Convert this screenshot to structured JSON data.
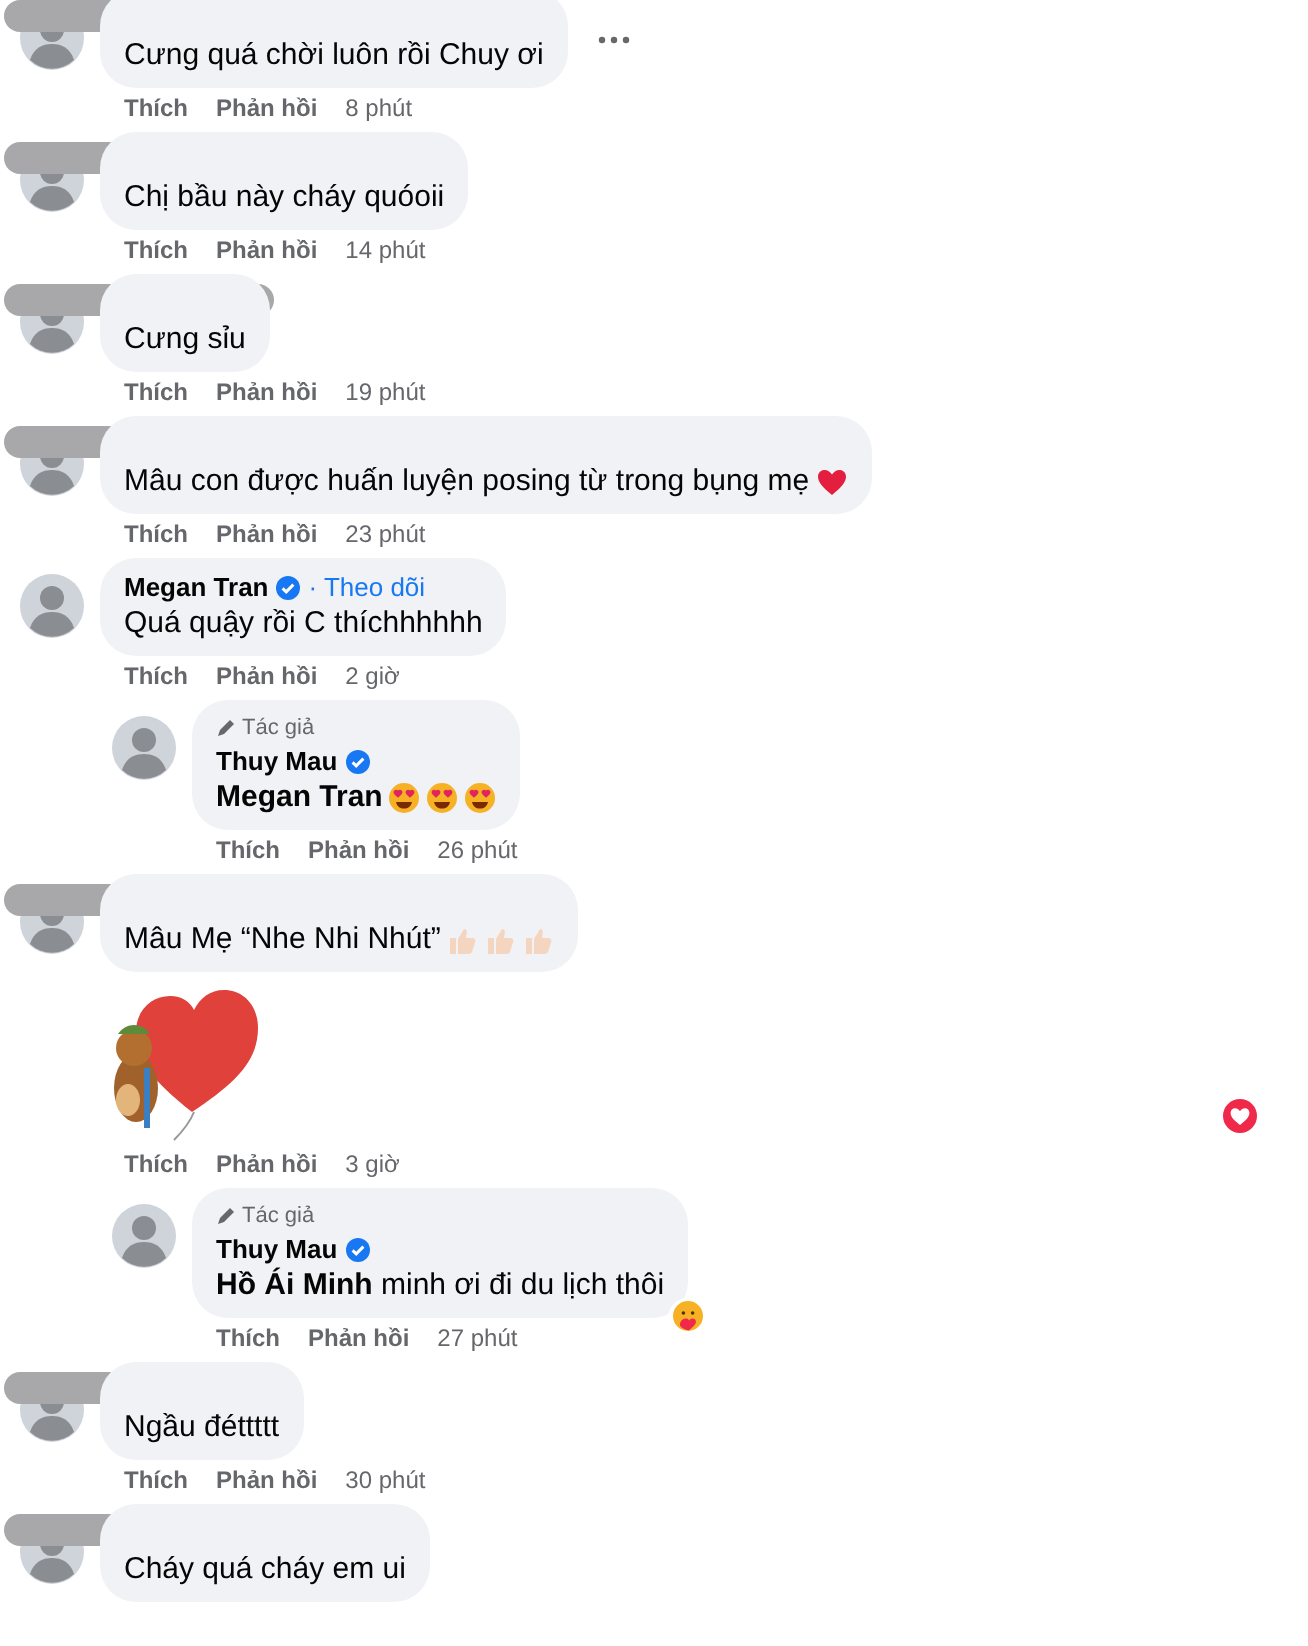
{
  "comments": [
    {
      "kind": "comment",
      "name_blurred": true,
      "text": "Cưng quá chời luôn rồi Chuy ơi",
      "more_menu": true,
      "actions": [
        "Thích",
        "Phản hồi"
      ],
      "time": "8 phút"
    },
    {
      "kind": "comment",
      "name_blurred": true,
      "text": "Chị bầu này cháy quóoii",
      "actions": [
        "Thích",
        "Phản hồi"
      ],
      "time": "14 phút"
    },
    {
      "kind": "comment",
      "name_blurred": true,
      "text": "Cưng sỉu",
      "actions": [
        "Thích",
        "Phản hồi"
      ],
      "time": "19 phút"
    },
    {
      "kind": "comment",
      "name_blurred": true,
      "text": "Mâu con được huấn luyện posing từ trong bụng mẹ",
      "trailing_icons": [
        {
          "kind": "heart"
        }
      ],
      "actions": [
        "Thích",
        "Phản hồi"
      ],
      "time": "23 phút"
    },
    {
      "kind": "comment",
      "name": "Megan Tran",
      "verified": true,
      "follow": "· Theo dõi",
      "text": "Quá quậy rồi C thíchhhhhh",
      "actions": [
        "Thích",
        "Phản hồi"
      ],
      "time": "2 giờ"
    },
    {
      "kind": "reply",
      "badge": "Tác giả",
      "name": "Thuy Mau",
      "verified": true,
      "text": "**Megan Tran**",
      "trailing_icons": [
        {
          "kind": "heart-eyes"
        },
        {
          "kind": "heart-eyes"
        },
        {
          "kind": "heart-eyes"
        }
      ],
      "actions": [
        "Thích",
        "Phản hồi"
      ],
      "time": "26 phút"
    },
    {
      "kind": "comment",
      "name_blurred": true,
      "text": "Mâu Mẹ “Nhe Nhi Nhút”",
      "trailing_icons": [
        {
          "kind": "thumbs-up"
        },
        {
          "kind": "thumbs-up"
        },
        {
          "kind": "thumbs-up"
        }
      ],
      "sticker": true,
      "reaction": {
        "kind": "love"
      },
      "actions": [
        "Thích",
        "Phản hồi"
      ],
      "time": "3 giờ"
    },
    {
      "kind": "reply",
      "badge": "Tác giả",
      "name": "Thuy Mau",
      "verified": true,
      "text": "**Hồ Ái Minh** minh ơi đi du lịch thôi",
      "reaction": {
        "kind": "care"
      },
      "actions": [
        "Thích",
        "Phản hồi"
      ],
      "time": "27 phút"
    },
    {
      "kind": "comment",
      "name_blurred": true,
      "text": "Ngầu đéttttt",
      "actions": [
        "Thích",
        "Phản hồi"
      ],
      "time": "30 phút"
    },
    {
      "kind": "comment",
      "name_blurred": true,
      "text": "Cháy quá cháy em ui"
    }
  ]
}
